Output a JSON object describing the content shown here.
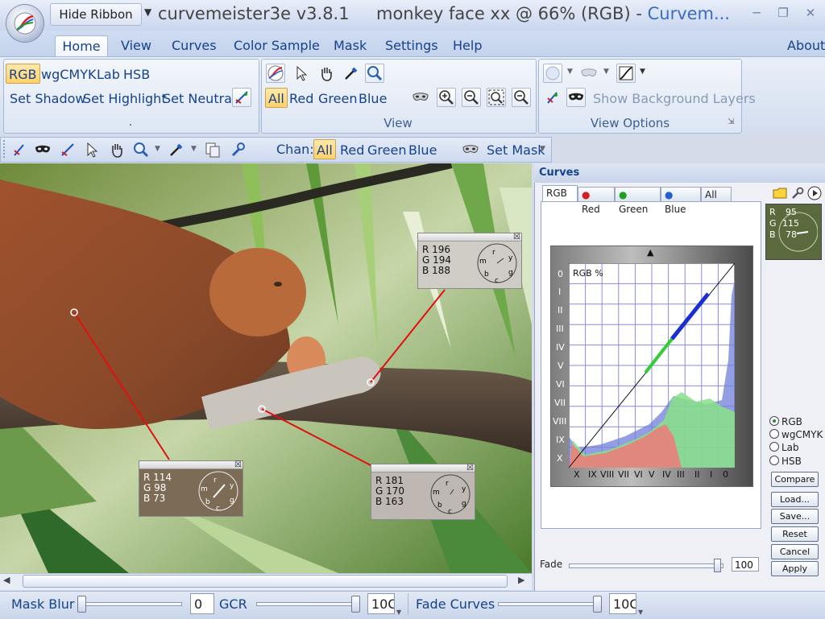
{
  "window": {
    "qat_button": "Hide Ribbon",
    "app_name": "curvemeister3e v3.8.1",
    "document": "monkey face xx @ 66% (RGB) - ",
    "app_short": "Curvem..."
  },
  "menu_tabs": [
    "Home",
    "View",
    "Curves",
    "Color Sample",
    "Mask",
    "Settings",
    "Help"
  ],
  "about": "About",
  "ribbon": {
    "color_modes": [
      "RGB",
      "wgCMYK",
      "Lab",
      "HSB"
    ],
    "set_buttons": [
      "Set Shadow",
      "Set Highlight",
      "Set Neutral"
    ],
    "group1_label": ".",
    "view_channels": [
      "All",
      "Red",
      "Green",
      "Blue"
    ],
    "view_label": "View",
    "show_bg_layers": "Show Background Layers",
    "view_options_label": "View Options"
  },
  "toolbar": {
    "chan_label": "Chan:",
    "channels": [
      "All",
      "Red",
      "Green",
      "Blue"
    ],
    "set_mask": "Set Mask"
  },
  "samples": [
    {
      "r": "R 196",
      "g": "G 194",
      "b": "B 188"
    },
    {
      "r": "R 114",
      "g": "G  98",
      "b": "B  73"
    },
    {
      "r": "R 181",
      "g": "G 170",
      "b": "B 163"
    }
  ],
  "curves": {
    "title": "Curves",
    "tabs": [
      "RGB",
      "Red",
      "Green",
      "Blue",
      "All"
    ],
    "graph_label": "RGB %",
    "y_ticks": [
      "0",
      "I",
      "II",
      "III",
      "IV",
      "V",
      "VI",
      "VII",
      "VIII",
      "IX",
      "X"
    ],
    "x_ticks": [
      "X",
      "IX",
      "VIII",
      "VII",
      "VI",
      "V",
      "IV",
      "III",
      "II",
      "I",
      "0"
    ],
    "preview": {
      "r": "R",
      "rv": "95",
      "g": "G",
      "gv": "115",
      "b": "B",
      "bv": "78"
    },
    "modes": [
      "RGB",
      "wgCMYK",
      "Lab",
      "HSB"
    ],
    "selected_mode": "RGB",
    "buttons": [
      "Compare",
      "Load...",
      "Save...",
      "Reset",
      "Cancel",
      "Apply"
    ],
    "fade_label": "Fade",
    "fade_value": "100",
    "fade_level": 1.0
  },
  "statusbar": {
    "mask_blur_label": "Mask Blur",
    "mask_blur_value": "0",
    "mask_blur_level": 0,
    "gcr_label": "GCR",
    "gcr_value": "10C",
    "gcr_level": 1.0,
    "fade_curves_label": "Fade Curves",
    "fade_curves_value": "10C",
    "fade_curves_level": 1.0
  },
  "colors": {
    "accent": "#15428b",
    "ribbon_bg": "#dde6f4",
    "selected": "#ffd26b",
    "sample_line": "#e01010"
  }
}
